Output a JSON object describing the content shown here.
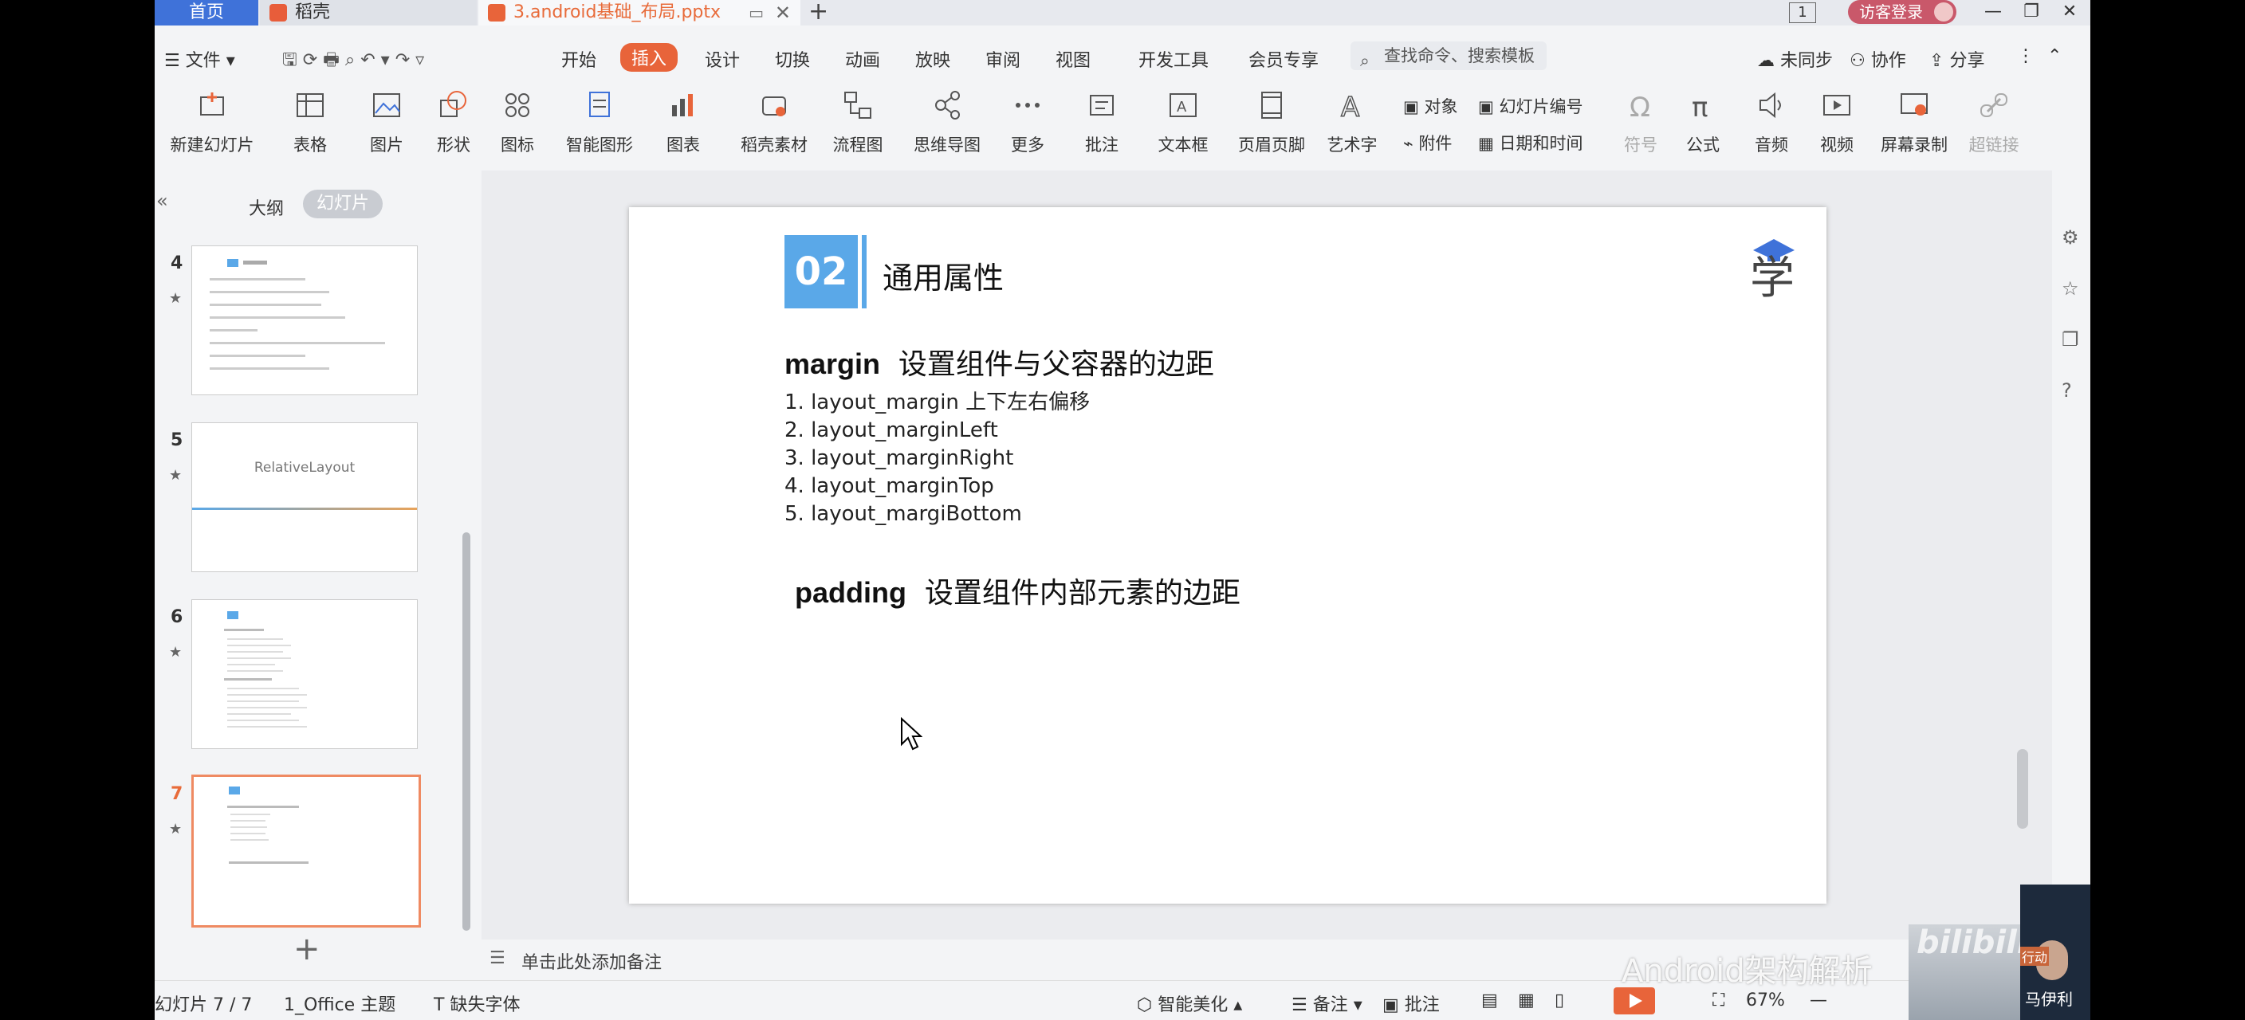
{
  "titlebar": {
    "home": "首页",
    "tabs": [
      {
        "label": "稻壳",
        "icon": "docer-icon",
        "color": "#e85d3a"
      },
      {
        "label": "3.android基础_布局.pptx",
        "icon": "ppt-file-icon",
        "color": "#e8643a"
      }
    ],
    "page_counter": "1",
    "login": "访客登录"
  },
  "menu": {
    "file": "文件",
    "items": [
      "开始",
      "插入",
      "设计",
      "切换",
      "动画",
      "放映",
      "审阅",
      "视图",
      "开发工具",
      "会员专享"
    ],
    "active": "插入",
    "search_placeholder": "查找命令、搜索模板",
    "sync": "未同步",
    "collab": "协作",
    "share": "分享"
  },
  "ribbon": {
    "buttons": [
      "新建幻灯片",
      "表格",
      "图片",
      "形状",
      "图标",
      "智能图形",
      "图表",
      "稻壳素材",
      "流程图",
      "思维导图",
      "更多",
      "批注",
      "文本框",
      "页眉页脚",
      "艺术字"
    ],
    "small": [
      "对象",
      "幻灯片编号",
      "附件",
      "日期和时间"
    ],
    "right_buttons": [
      "符号",
      "公式",
      "音频",
      "视频",
      "屏幕录制",
      "超链接"
    ]
  },
  "leftpanel": {
    "outline": "大纲",
    "slides": "幻灯片",
    "thumbs": [
      {
        "num": "4"
      },
      {
        "num": "5",
        "title": "RelativeLayout"
      },
      {
        "num": "6"
      },
      {
        "num": "7"
      }
    ]
  },
  "slide": {
    "number": "02",
    "title": "通用属性",
    "margin_key": "margin",
    "margin_text": "设置组件与父容器的边距",
    "items": [
      "1.   layout_margin 上下左右偏移",
      "2.   layout_marginLeft",
      "3.   layout_marginRight",
      "4.   layout_marginTop",
      "5.   layout_margiBottom"
    ],
    "padding_key": "padding",
    "padding_text": "设置组件内部元素的边距",
    "accent": "#5aa8e8"
  },
  "notes": {
    "placeholder": "单击此处添加备注"
  },
  "status": {
    "slide_count": "幻灯片 7 / 7",
    "theme": "1_Office 主题",
    "missing_font": "缺失字体",
    "beautify": "智能美化",
    "notes": "备注",
    "comments": "批注",
    "zoom": "67%"
  },
  "overlay": {
    "watermark": "Android架构解析",
    "bili": "bilibili",
    "webcam_tag": "行动",
    "webcam_name": "马伊利"
  }
}
